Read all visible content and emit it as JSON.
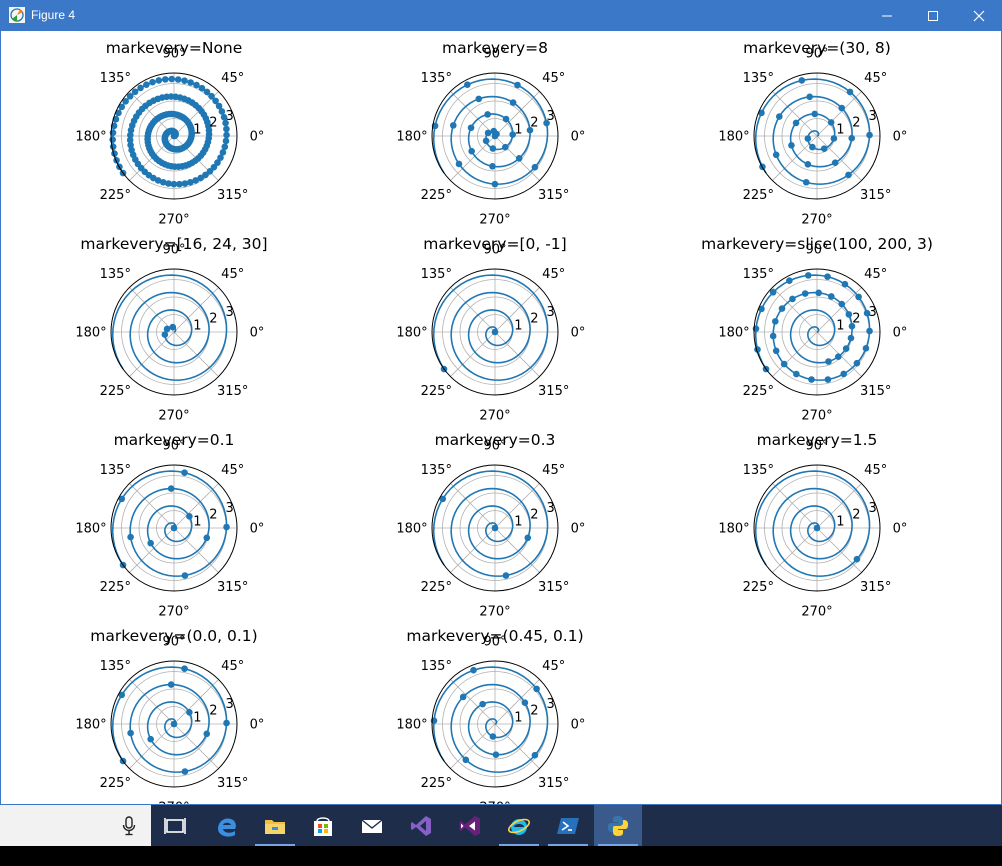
{
  "window": {
    "title": "Figure 4",
    "controls": [
      "minimize",
      "maximize",
      "close"
    ]
  },
  "colors": {
    "titlebar": "#3c78c8",
    "series": "#1f77b4",
    "taskbar": "#1d2d4a"
  },
  "angle_labels": [
    "0°",
    "45°",
    "90°",
    "135°",
    "180°",
    "225°",
    "270°",
    "315°"
  ],
  "radial_labels": [
    "1",
    "2",
    "3"
  ],
  "chart_data": [
    {
      "type": "polar-line",
      "title": "markevery=None",
      "r": "0 to 3.6",
      "theta": "2·π·r",
      "markers": "all",
      "rlim": [
        0,
        3.6
      ]
    },
    {
      "type": "polar-line",
      "title": "markevery=8",
      "markers": "every 8th point",
      "rlim": [
        0,
        3.6
      ]
    },
    {
      "type": "polar-line",
      "title": "markevery=(30, 8)",
      "markers": "start 30, every 8th",
      "rlim": [
        0,
        3.6
      ]
    },
    {
      "type": "polar-line",
      "title": "markevery=[16, 24, 30]",
      "markers": "indices 16, 24, 30",
      "rlim": [
        0,
        3.6
      ]
    },
    {
      "type": "polar-line",
      "title": "markevery=[0, -1]",
      "markers": "first and last",
      "rlim": [
        0,
        3.6
      ]
    },
    {
      "type": "polar-line",
      "title": "markevery=slice(100, 200, 3)",
      "markers": "indices 100–200 step 3",
      "rlim": [
        0,
        3.6
      ]
    },
    {
      "type": "polar-line",
      "title": "markevery=0.1",
      "markers": "every 0.1 of path length",
      "rlim": [
        0,
        3.6
      ]
    },
    {
      "type": "polar-line",
      "title": "markevery=0.3",
      "markers": "every 0.3 of path length",
      "rlim": [
        0,
        3.6
      ]
    },
    {
      "type": "polar-line",
      "title": "markevery=1.5",
      "markers": "every 1.5 data units",
      "rlim": [
        0,
        3.6
      ]
    },
    {
      "type": "polar-line",
      "title": "markevery=(0.0, 0.1)",
      "markers": "offset 0.0, every 0.1",
      "rlim": [
        0,
        3.6
      ]
    },
    {
      "type": "polar-line",
      "title": "markevery=(0.45, 0.1)",
      "markers": "offset 0.45, every 0.1",
      "rlim": [
        0,
        3.6
      ]
    }
  ],
  "taskbar": {
    "apps": [
      "task-view",
      "edge",
      "file-explorer",
      "store",
      "mail",
      "visual-studio-code",
      "visual-studio",
      "internet-explorer",
      "powershell",
      "python"
    ]
  }
}
